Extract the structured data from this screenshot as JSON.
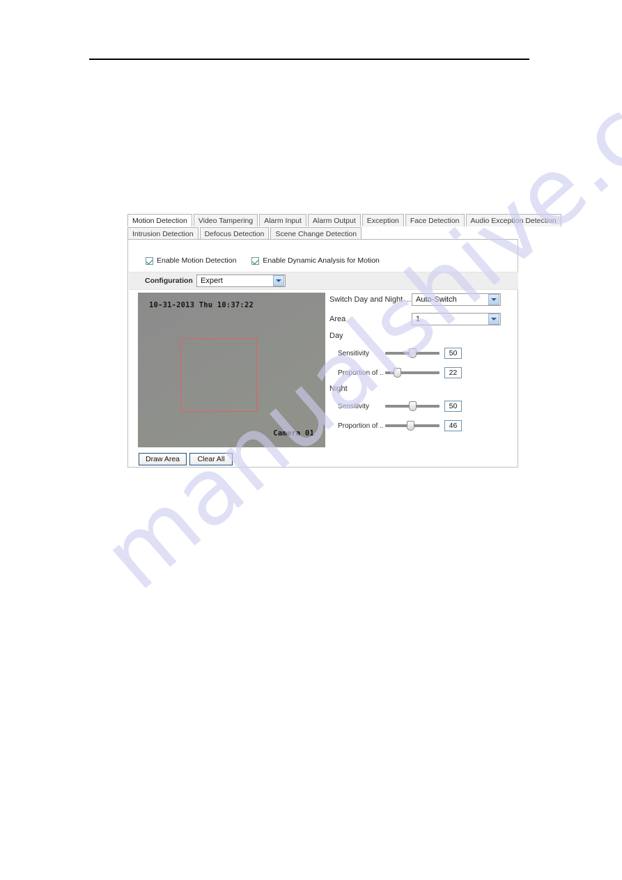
{
  "watermark": {
    "text": "manualshive.com"
  },
  "tabs": {
    "row1": [
      {
        "label": "Motion Detection",
        "active": true
      },
      {
        "label": "Video Tampering",
        "active": false
      },
      {
        "label": "Alarm Input",
        "active": false
      },
      {
        "label": "Alarm Output",
        "active": false
      },
      {
        "label": "Exception",
        "active": false
      },
      {
        "label": "Face Detection",
        "active": false
      },
      {
        "label": "Audio Exception Detection",
        "active": false
      }
    ],
    "row2": [
      {
        "label": "Intrusion Detection",
        "active": false
      },
      {
        "label": "Defocus Detection",
        "active": false
      },
      {
        "label": "Scene Change Detection",
        "active": false
      }
    ]
  },
  "checkboxes": [
    {
      "label": "Enable Motion Detection",
      "checked": true
    },
    {
      "label": "Enable Dynamic Analysis for Motion",
      "checked": true
    }
  ],
  "configuration": {
    "label": "Configuration",
    "value": "Expert"
  },
  "video": {
    "timestamp": "10-31-2013 Thu 10:37:22",
    "camera_label": "Camera 01",
    "area_color": "#e2615e"
  },
  "video_buttons": [
    {
      "label": "Draw Area"
    },
    {
      "label": "Clear All"
    }
  ],
  "controls": {
    "switch_day_night": {
      "label": "Switch Day and Night ...",
      "value": "Auto-Switch"
    },
    "area": {
      "label": "Area",
      "value": "1"
    },
    "day_label": "Day",
    "night_label": "Night",
    "day": [
      {
        "label": "Sensitivity",
        "value": "50",
        "percent": 50
      },
      {
        "label": "Proportion of ...",
        "value": "22",
        "percent": 22
      }
    ],
    "night": [
      {
        "label": "Sensitivity",
        "value": "50",
        "percent": 50
      },
      {
        "label": "Proportion of ...",
        "value": "46",
        "percent": 46
      }
    ]
  }
}
